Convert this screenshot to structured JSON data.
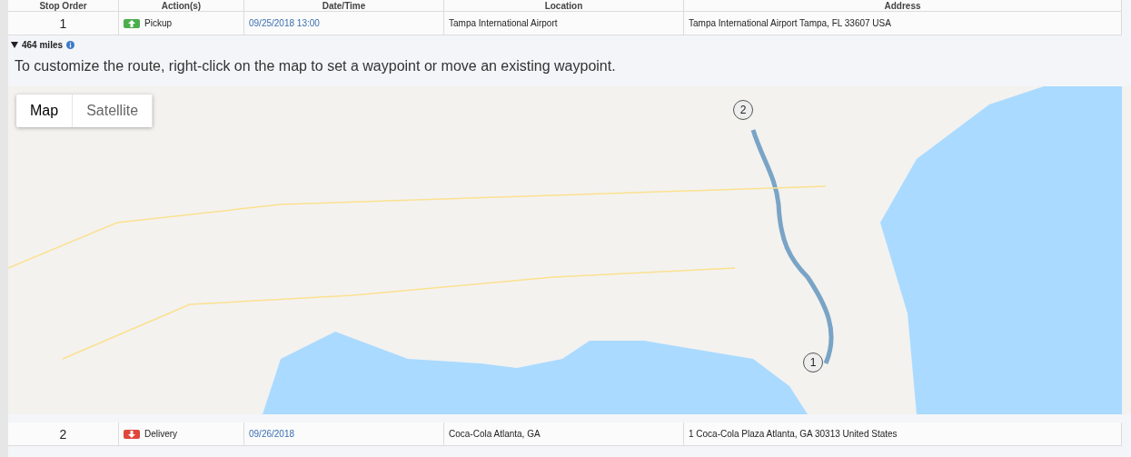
{
  "table": {
    "columns": [
      "Stop Order",
      "Action(s)",
      "Date/Time",
      "Location",
      "Address"
    ],
    "stops": [
      {
        "stop_order": "1",
        "action": {
          "kind": "pickup",
          "label": "Pickup"
        },
        "date_time": "09/25/2018 13:00",
        "location": "Tampa International Airport",
        "address": "Tampa International Airport Tampa, FL 33607 USA",
        "details": {
          "expanded": true,
          "distance": "464 miles",
          "instruction": "To customize the route, right-click on the map to set a waypoint or move an existing waypoint.",
          "map": {
            "map_types": [
              {
                "label": "Map",
                "selected": true
              },
              {
                "label": "Satellite",
                "selected": false
              }
            ],
            "markers": [
              {
                "label": "1",
                "kind": "origin"
              },
              {
                "label": "2",
                "kind": "destination"
              }
            ]
          }
        }
      },
      {
        "stop_order": "2",
        "action": {
          "kind": "delivery",
          "label": "Delivery"
        },
        "date_time": "09/26/2018",
        "location": "Coca-Cola Atlanta, GA",
        "address": "1 Coca-Cola Plaza Atlanta, GA 30313 United States"
      }
    ]
  }
}
